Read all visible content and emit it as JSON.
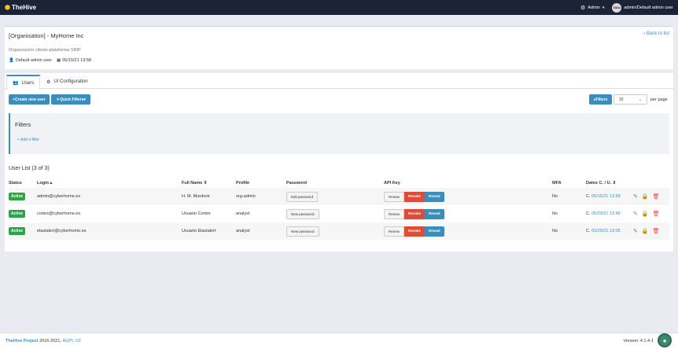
{
  "navbar": {
    "brand": "TheHive",
    "admin_menu": "Admin",
    "avatar_initials": "DAU",
    "user_label": "admin/Default admin user"
  },
  "org": {
    "title": "[Organisation] - MyHome Inc",
    "back_link": "Back to list",
    "description": "Organización cliente plataforma SIRP",
    "created_by": "Default admin user",
    "created_at": "05/15/21 13:58"
  },
  "tabs": [
    {
      "label": "Users",
      "active": true
    },
    {
      "label": "UI Configuration",
      "active": false
    }
  ],
  "toolbar": {
    "create_label": "Create new user",
    "quick_filters_label": "Quick Filters",
    "filters_label": "Filters",
    "page_size": "15",
    "per_page_label": "per page"
  },
  "filters": {
    "title": "Filters",
    "add_filter_label": "Add a filter"
  },
  "list": {
    "title": "User List (3 of 3)",
    "columns": [
      "Status",
      "Login",
      "Full Name",
      "Profile",
      "Password",
      "API Key",
      "MFA",
      "Dates C. / U."
    ],
    "rows": [
      {
        "status": "Active",
        "login": "admin@cyberhome.es",
        "full_name": "H. M. Murdock",
        "profile": "org-admin",
        "password_action": "Edit password",
        "api_renew": "Renew",
        "api_revoke": "Revoke",
        "api_reveal": "Reveal",
        "mfa": "No",
        "date_prefix": "C.",
        "date": "05/15/21 13:59"
      },
      {
        "status": "Active",
        "login": "cortex@cyberhome.es",
        "full_name": "Usuario Cortex",
        "profile": "analyst",
        "password_action": "New password",
        "api_renew": "Renew",
        "api_revoke": "Revoke",
        "api_reveal": "Reveal",
        "mfa": "No",
        "date_prefix": "C.",
        "date": "05/29/21 13:49"
      },
      {
        "status": "Active",
        "login": "elastalert@cyberhome.es",
        "full_name": "Usuario Elastalert",
        "profile": "analyst",
        "password_action": "New password",
        "api_renew": "Renew",
        "api_revoke": "Revoke",
        "api_reveal": "Reveal",
        "mfa": "No",
        "date_prefix": "C.",
        "date": "05/29/21 13:05"
      }
    ]
  },
  "footer": {
    "project": "TheHive Project",
    "years": "2016-2021,",
    "license": "AGPL-V3",
    "version": "Version: 4.1.4-1"
  },
  "colors": {
    "navbar": "#1a2436",
    "primary": "#3c8dbc",
    "success": "#28a745",
    "danger": "#dd4b39"
  }
}
